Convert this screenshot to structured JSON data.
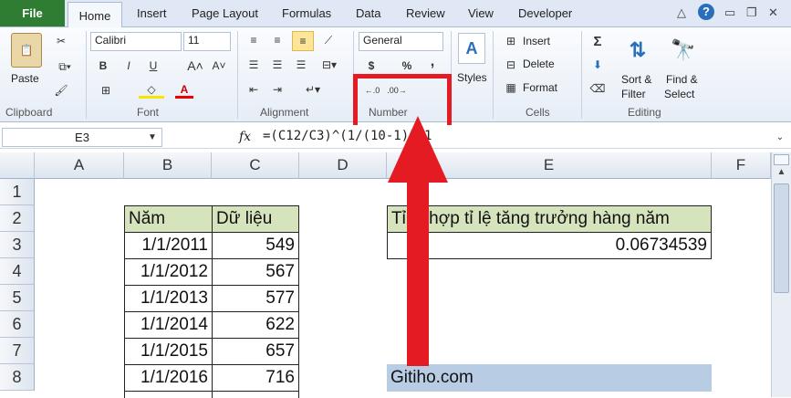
{
  "tabs": {
    "file": "File",
    "items": [
      "Home",
      "Insert",
      "Page Layout",
      "Formulas",
      "Data",
      "Review",
      "View",
      "Developer"
    ]
  },
  "clipboard": {
    "paste": "Paste",
    "label": "Clipboard"
  },
  "font": {
    "name": "Calibri",
    "size": "11",
    "label": "Font",
    "bold": "B",
    "italic": "I",
    "underline": "U"
  },
  "alignment": {
    "label": "Alignment"
  },
  "number": {
    "format": "General",
    "currency": "$",
    "percent": "%",
    "comma": ",",
    "inc_dec": ".0→.00",
    "dec_dec": ".00→.0",
    "label": "Number"
  },
  "styles": {
    "label": "Styles"
  },
  "cells": {
    "insert": "Insert",
    "delete": "Delete",
    "format": "Format",
    "label": "Cells"
  },
  "editing": {
    "sum": "Σ",
    "sort": "Sort &",
    "filter": "Filter",
    "find": "Find &",
    "select": "Select",
    "label": "Editing"
  },
  "formula_bar": {
    "name_box": "E3",
    "fx": "fx",
    "formula": "=(C12/C3)^(1/(10-1))-1"
  },
  "columns": [
    "A",
    "B",
    "C",
    "D",
    "E",
    "F"
  ],
  "rows": [
    "1",
    "2",
    "3",
    "4",
    "5",
    "6",
    "7",
    "8"
  ],
  "table": {
    "headers": [
      "Năm",
      "Dữ liệu"
    ],
    "rows": [
      [
        "1/1/2011",
        "549"
      ],
      [
        "1/1/2012",
        "567"
      ],
      [
        "1/1/2013",
        "577"
      ],
      [
        "1/1/2014",
        "622"
      ],
      [
        "1/1/2015",
        "657"
      ],
      [
        "1/1/2016",
        "716"
      ]
    ]
  },
  "result": {
    "header": "Tỉ lệ hợp tỉ lệ tăng trưởng hàng năm",
    "value": "0.06734539"
  },
  "watermark": "Gitiho.com",
  "colors": {
    "header_fill": "#d6e4bd",
    "watermark_fill": "#b8cce4",
    "highlight": "#e51b24"
  }
}
